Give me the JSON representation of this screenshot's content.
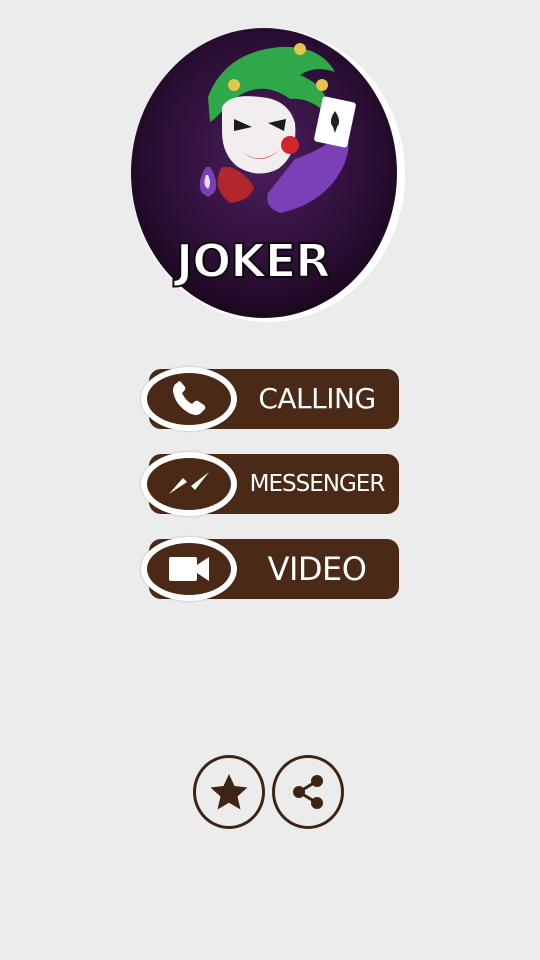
{
  "logo": {
    "text": "JOKER"
  },
  "actions": {
    "calling_label": "CALLING",
    "messenger_label": "MESSENGER",
    "video_label": "VIDEO"
  },
  "icons": {
    "calling": "phone-icon",
    "messenger": "messenger-bolt-icon",
    "video": "video-camera-icon",
    "rate": "star-icon",
    "share": "share-icon"
  },
  "colors": {
    "background": "#ececec",
    "button": "#4a2a17",
    "button_text": "#ffffff",
    "logo_bg": "#2a0d33",
    "logo_purple": "#7b3fb8",
    "logo_green": "#2fa84a"
  }
}
